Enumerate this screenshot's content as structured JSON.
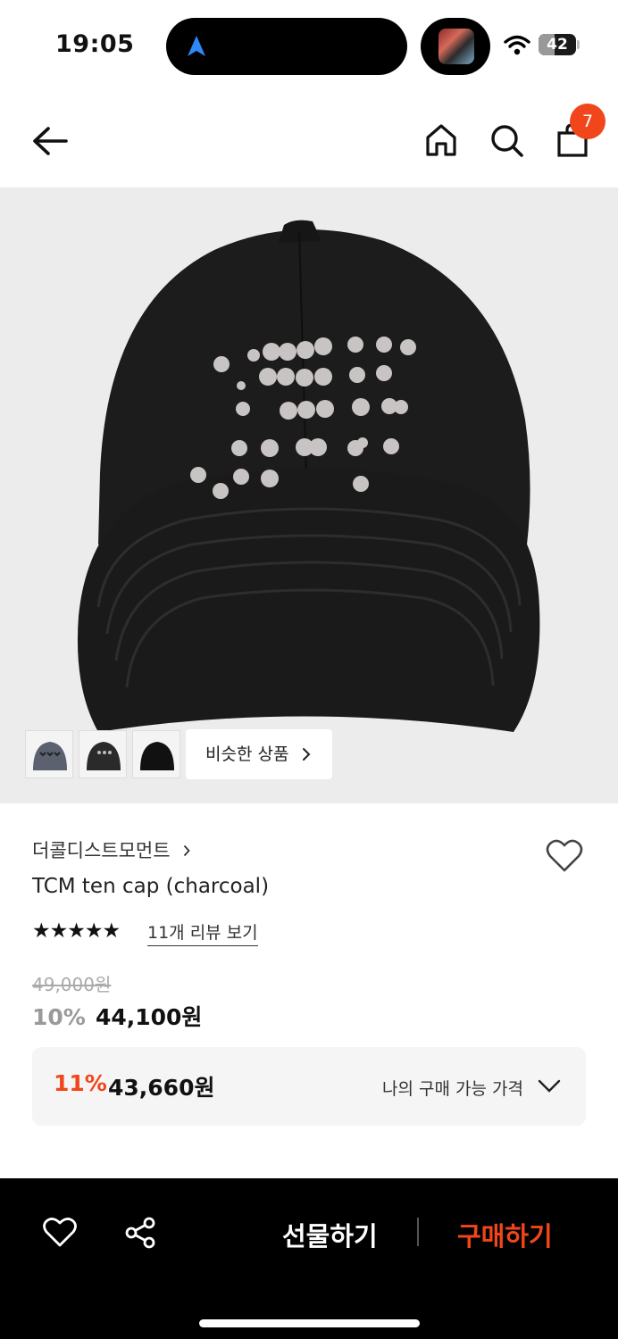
{
  "status_bar": {
    "time": "19:05",
    "battery": "42",
    "battery_level": 0.42,
    "icons": [
      "navigation-arrow-icon",
      "now-playing-album-icon",
      "wifi-icon",
      "battery-icon"
    ]
  },
  "header": {
    "cart_count": "7",
    "icons": [
      "back-arrow-icon",
      "home-icon",
      "search-icon",
      "shopping-bag-icon"
    ]
  },
  "gallery": {
    "similar_label": "비슷한 상품",
    "thumbnails": [
      "thumbnail-1",
      "thumbnail-2",
      "thumbnail-3"
    ]
  },
  "product": {
    "brand": "더콜디스트모먼트",
    "name": "TCM ten cap (charcoal)",
    "stars": "★★★★★",
    "rating_value": 5,
    "review_link": "11개 리뷰 보기",
    "original_price": "49,000원",
    "discount_pct": "10%",
    "sale_price": "44,100원"
  },
  "my_price": {
    "pct": "11%",
    "price": "43,660원",
    "label": "나의 구매 가능 가격"
  },
  "bottom_bar": {
    "gift_label": "선물하기",
    "buy_label": "구매하기"
  },
  "colors": {
    "accent": "#f1461b",
    "bottom_bar_bg": "#000000",
    "hero_bg": "#ececec"
  }
}
